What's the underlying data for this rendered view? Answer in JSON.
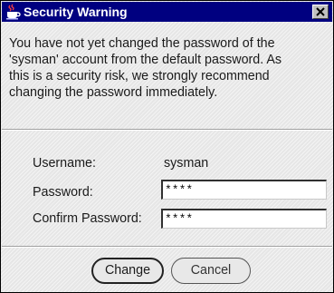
{
  "window": {
    "title": "Security Warning",
    "title_icon": "java-coffee-cup-icon",
    "close_icon": "close-x-icon"
  },
  "message": {
    "lines": [
      "You have not yet changed the password of the",
      "'sysman' account from the default password.  As",
      "this is a security risk, we strongly recommend",
      "changing the password immediately."
    ]
  },
  "form": {
    "username_label": "Username:",
    "username_value": "sysman",
    "password_label": "Password:",
    "password_value": "****",
    "confirm_label": "Confirm Password:",
    "confirm_value": "****"
  },
  "buttons": {
    "change_label": "Change",
    "cancel_label": "Cancel"
  },
  "colors": {
    "titlebar": "#000080",
    "dialog_background": "#e6e6e6"
  }
}
